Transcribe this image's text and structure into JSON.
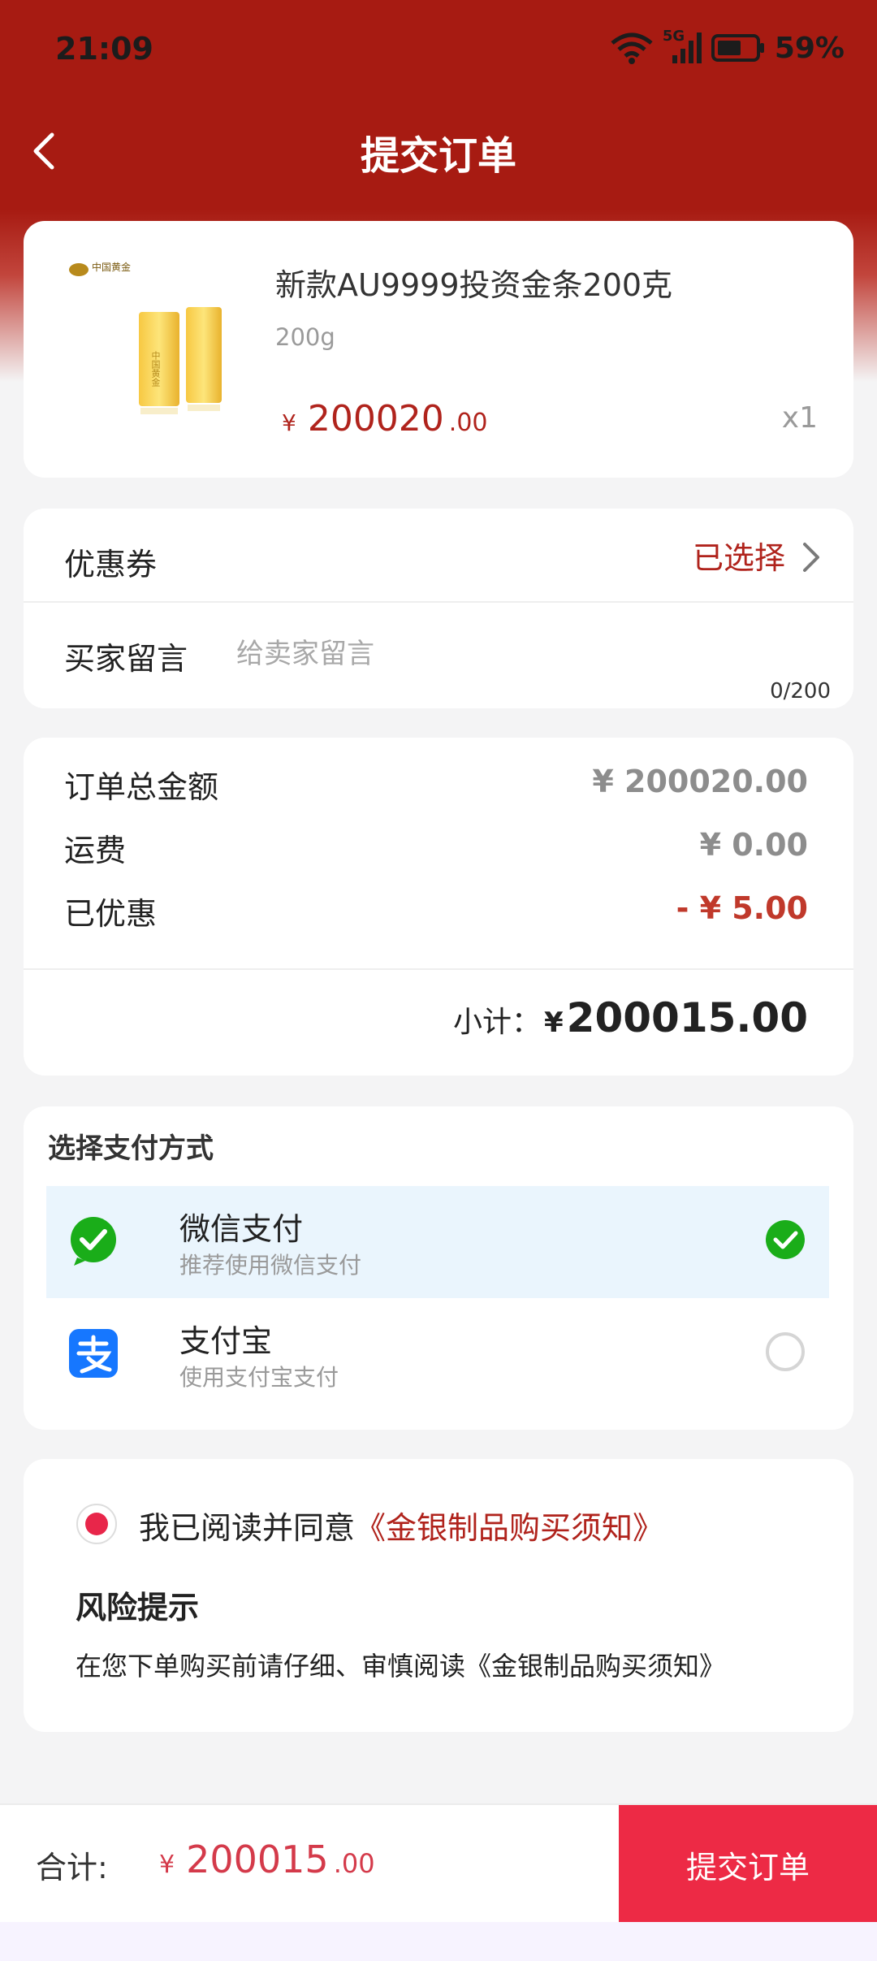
{
  "status": {
    "time": "21:09",
    "network": "5G",
    "battery": "59%"
  },
  "nav": {
    "title": "提交订单"
  },
  "product": {
    "name": "新款AU9999投资金条200克",
    "spec": "200g",
    "price_symbol": "¥",
    "price_int": "200020",
    "price_dec": ".00",
    "quantity": "x1",
    "brand_logo_text": "中国黄金",
    "bar_text": "中国黄金"
  },
  "coupon": {
    "label": "优惠券",
    "value": "已选择"
  },
  "message": {
    "label": "买家留言",
    "placeholder": "给卖家留言",
    "counter": "0/200"
  },
  "summary": {
    "total_label": "订单总金额",
    "total_value": "¥ 200020.00",
    "shipping_label": "运费",
    "shipping_value": "¥ 0.00",
    "discount_label": "已优惠",
    "discount_value": "- ¥  5.00",
    "subtotal_label": "小计：",
    "subtotal_symbol": "¥",
    "subtotal_value": "200015.00"
  },
  "payment": {
    "title": "选择支付方式",
    "methods": [
      {
        "name": "微信支付",
        "sub": "推荐使用微信支付",
        "selected": true,
        "icon": "wechat-pay-icon"
      },
      {
        "name": "支付宝",
        "sub": "使用支付宝支付",
        "selected": false,
        "icon": "alipay-icon"
      }
    ]
  },
  "terms": {
    "agree_text": "我已阅读并同意",
    "agree_link": "《金银制品购买须知》",
    "risk_title": "风险提示",
    "risk_text": "在您下单购买前请仔细、审慎阅读《金银制品购买须知》"
  },
  "footer": {
    "total_label": "合计:",
    "symbol": "¥",
    "amount_int": "200015",
    "amount_dec": ".00",
    "submit_label": "提交订单"
  },
  "colors": {
    "header_red": "#a71b12",
    "accent_red": "#b0231c",
    "submit_red": "#ed2a45",
    "wechat_green": "#1aad19",
    "alipay_blue": "#1677ff"
  }
}
